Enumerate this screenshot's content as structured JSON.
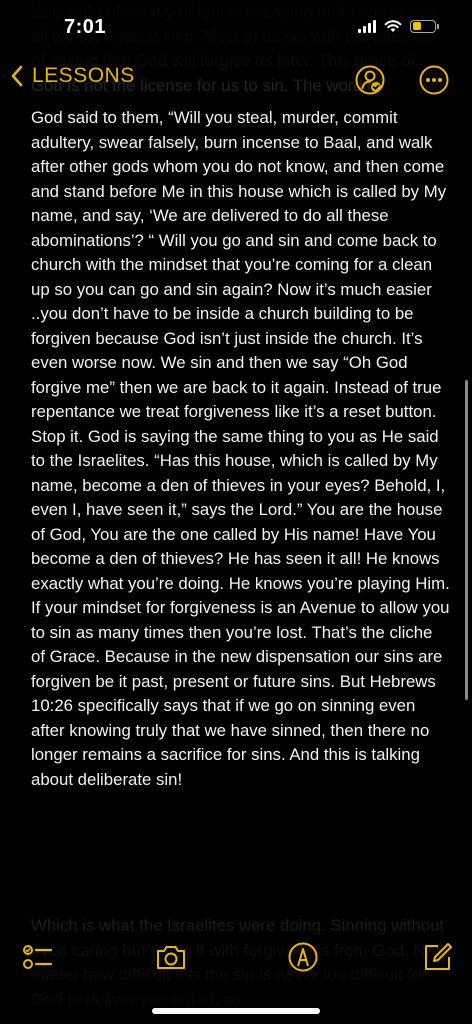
{
  "status_bar": {
    "time": "7:01"
  },
  "nav": {
    "back_label": "LESSONS"
  },
  "note": {
    "ghost_top": "lose sight of what you feel is escaping and I say to you all we sin against Him. Most of us sin with the intention of saying that God will forgive us later. This grace of God is not the license for us to sin. The word of",
    "body": "God said to them, “Will you steal, murder, commit adultery, swear falsely, burn incense to Baal, and walk after other gods whom you do not know, and then come and stand before Me in this house which is called by My name, and say, ‘We are delivered to do all these abominations’? “  Will you go and sin and come back to church with the mindset that you’re coming for a clean up so you can go and sin again? Now it’s much easier ..you don’t have to be inside a church building to be forgiven because God isn’t just inside the church. It’s even worse now. We sin and then we say “Oh God forgive me” then we are back to it again. Instead of true repentance we treat forgiveness like it’s a reset button. Stop it. God is saying the same thing to you as He said to the Israelites. “Has this house, which is called by My name, become a den of thieves in your eyes? Behold, I, even I, have seen it,” says the Lord.” You are the house of God, You are the one called by His name! Have You become a den of thieves? He has seen it all! He knows exactly what you’re doing. He knows you’re playing Him. If your mindset for forgiveness is an Avenue to allow you to sin as many times then you’re lost. That’s the cliche of Grace. Because in the new dispensation our sins are forgiven be it past, present or future sins. But Hebrews 10:26 specifically says that if we go on sinning even after knowing truly that we have sinned, then there no longer remains a sacrifice for sins. And this is talking about deliberate sin!",
    "ghost_bottom": "Which is what the Israelites were doing. Sinning without even caring but doing it with forgiveness from God. No matter how difficult it is the sin is never too difficult for God to deliver you out of, so"
  },
  "colors": {
    "accent": "#e9b508",
    "background": "#000000",
    "text": "#f2f2f2"
  },
  "icons": {
    "back": "chevron-left-icon",
    "collaborate": "person-share-icon",
    "more": "ellipsis-circle-icon",
    "checklist": "checklist-icon",
    "camera": "camera-icon",
    "markup": "pen-circle-icon",
    "compose": "compose-icon"
  }
}
